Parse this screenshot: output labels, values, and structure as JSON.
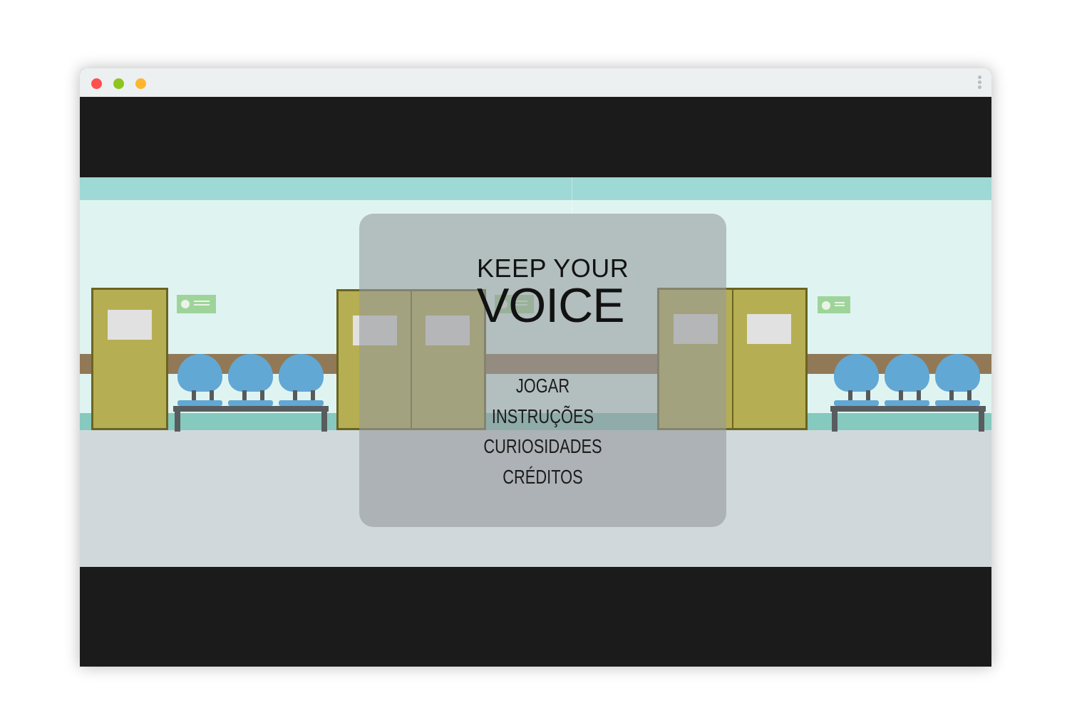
{
  "logo": {
    "line1": "KEEP YOUR",
    "line2": "VOICE"
  },
  "menu": {
    "items": [
      "JOGAR",
      "INSTRUÇÕES",
      "CURIOSIDADES",
      "CRÉDITOS"
    ]
  },
  "colors": {
    "window_bg": "#1b1b1b",
    "titlebar": "#ecf0f1",
    "close_dot": "#ff4f4f",
    "minimize_dot": "#8dc51c",
    "zoom_dot": "#fdb630",
    "wall": "#dff4f1",
    "floor": "#d0d8db",
    "door": "#b6ae52",
    "chair": "#62a8d5"
  }
}
